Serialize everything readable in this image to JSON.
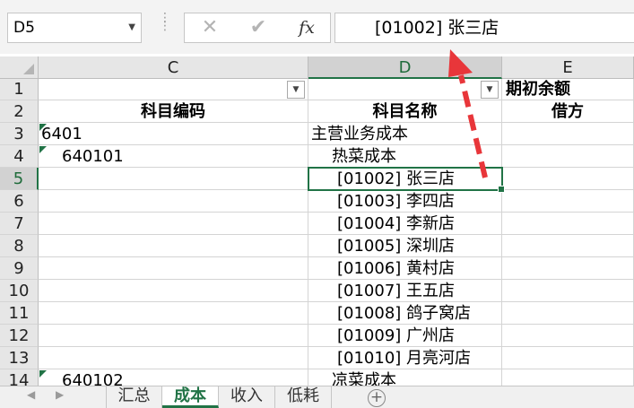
{
  "formula_bar": {
    "name_box": "D5",
    "cancel_icon": "✕",
    "enter_icon": "✔",
    "fx_label": "fx",
    "content": "[01002] 张三店"
  },
  "columns": [
    "C",
    "D",
    "E"
  ],
  "rows": [
    "1",
    "2",
    "3",
    "4",
    "5",
    "6",
    "7",
    "8",
    "9",
    "10",
    "11",
    "12",
    "13",
    "14"
  ],
  "cells": {
    "C2": "科目编码",
    "D2": "科目名称",
    "E1": "期初余额",
    "E2": "借方",
    "C3": "6401",
    "D3": "主营业务成本",
    "C4": "640101",
    "D4": "热菜成本",
    "D5": "[01002] 张三店",
    "D6": "[01003] 李四店",
    "D7": "[01004] 李新店",
    "D8": "[01005] 深圳店",
    "D9": "[01006] 黄村店",
    "D10": "[01007] 王五店",
    "D11": "[01008] 鸽子窝店",
    "D12": "[01009] 广州店",
    "D13": "[01010] 月亮河店",
    "C14": "640102",
    "D14": "凉菜成本"
  },
  "sheet_tabs": [
    "汇总",
    "成本",
    "收入",
    "低耗"
  ],
  "active_tab": "成本",
  "accent_color": "#217346",
  "annotation_color": "#e8363a"
}
